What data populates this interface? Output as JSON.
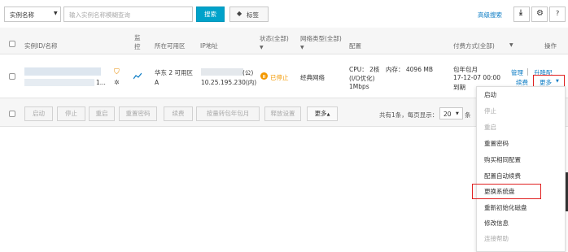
{
  "toolbar": {
    "filter_select": "实例名称",
    "search_placeholder": "输入实例名称模糊查询",
    "search_button": "搜索",
    "tag_button": "标签",
    "advanced_search": "高级搜索"
  },
  "table": {
    "headers": {
      "id_name": "实例ID/名称",
      "monitor": "监控",
      "zone": "所在可用区",
      "ip": "IP地址",
      "status": "状态(全部)",
      "network": "网络类型(全部)",
      "config": "配置",
      "billing": "付费方式(全部)",
      "actions": "操作"
    },
    "row": {
      "name_suffix": "1...",
      "zone": "华东 2 可用区 A",
      "ip_public_label": "(公)",
      "ip_private": "10.25.195.230(内)",
      "status": "已停止",
      "network": "经典网络",
      "config_cpu": "CPU： 2核",
      "config_mem": "内存： 4096 MB",
      "config_io": "(I/O优化)",
      "config_bw": "1Mbps",
      "billing_type": "包年包月",
      "billing_expire": "17-12-07 00:00",
      "billing_status": "到期",
      "action_manage": "管理",
      "action_renew": "续费",
      "action_upgrade": "升降配",
      "action_more": "更多"
    }
  },
  "bulk": {
    "buttons": [
      "启动",
      "停止",
      "重启",
      "重置密码",
      "续费",
      "按量转包年包月",
      "释放设置"
    ],
    "more": "更多",
    "pagination_text": "共有1条，每页显示：",
    "page_size": "20",
    "pagination_unit": "条"
  },
  "dropdown": {
    "items": [
      "启动",
      "停止",
      "重启",
      "重置密码",
      "购买相同配置",
      "配置自动续费",
      "更换系统盘",
      "重新初始化磁盘",
      "修改信息",
      "连接帮助"
    ],
    "disabled": [
      false,
      true,
      true,
      false,
      false,
      false,
      false,
      false,
      false,
      true
    ],
    "highlighted_index": 6
  },
  "colors": {
    "accent": "#00a2ca",
    "link": "#0a7bc4",
    "status_stopped": "#f39800",
    "highlight_border": "#e02020"
  }
}
